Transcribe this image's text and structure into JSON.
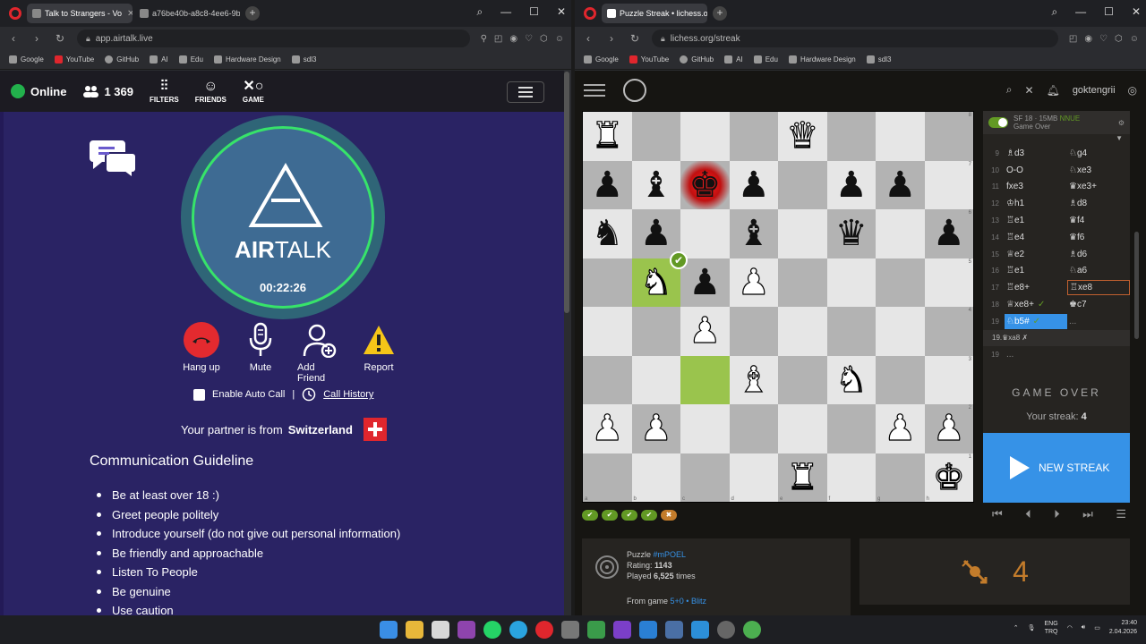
{
  "left_window": {
    "tabs": [
      {
        "label": "Talk to Strangers - Vo"
      },
      {
        "label": "a76be40b-a8c8-4ee6-9b8"
      }
    ],
    "url": "app.airtalk.live",
    "bookmarks": [
      "Google",
      "YouTube",
      "GitHub",
      "AI",
      "Edu",
      "Hardware Design",
      "sdl3"
    ]
  },
  "airtalk": {
    "status": "Online",
    "user_count": "1 369",
    "nav": {
      "filters": "FILTERS",
      "friends": "FRIENDS",
      "game": "GAME"
    },
    "logo_bold": "AIR",
    "logo_light": "TALK",
    "timer": "00:22:26",
    "actions": {
      "hangup": "Hang up",
      "mute": "Mute",
      "add_friend": "Add Friend",
      "report": "Report"
    },
    "auto_call": "Enable Auto Call",
    "separator": "|",
    "call_history": "Call History",
    "partner_prefix": "Your partner is from",
    "partner_country": "Switzerland",
    "guideline_title": "Communication Guideline",
    "guidelines": [
      "Be at least over 18 :)",
      "Greet people politely",
      "Introduce yourself (do not give out personal information)",
      "Be friendly and approachable",
      "Listen To People",
      "Be genuine",
      "Use caution"
    ]
  },
  "right_window": {
    "tabs": [
      {
        "label": "Puzzle Streak • lichess.org"
      }
    ],
    "url": "lichess.org/streak",
    "bookmarks": [
      "Google",
      "YouTube",
      "GitHub",
      "AI",
      "Edu",
      "Hardware Design",
      "sdl3"
    ]
  },
  "lichess": {
    "username": "goktengrii",
    "board": [
      [
        "wR",
        "",
        "",
        "",
        "wQ",
        "",
        "",
        ""
      ],
      [
        "bP",
        "bB",
        "bK",
        "bP",
        "",
        "bP",
        "bP",
        ""
      ],
      [
        "bN",
        "bP",
        "",
        "bB",
        "",
        "bQ",
        "",
        "bP"
      ],
      [
        "",
        "wN",
        "bP",
        "wP",
        "",
        "",
        "",
        ""
      ],
      [
        "",
        "",
        "wP",
        "",
        "",
        "",
        "",
        ""
      ],
      [
        "",
        "",
        "",
        "wB",
        "",
        "wN",
        "",
        ""
      ],
      [
        "wP",
        "wP",
        "",
        "",
        "",
        "",
        "wP",
        "wP"
      ],
      [
        "",
        "",
        "",
        "",
        "wR",
        "",
        "",
        "wK"
      ]
    ],
    "highlight_squares": [
      [
        3,
        1
      ],
      [
        5,
        2
      ]
    ],
    "check_square": [
      1,
      2
    ],
    "rank_labels": [
      "8",
      "7",
      "6",
      "5",
      "4",
      "3",
      "2",
      "1"
    ],
    "file_labels": [
      "a",
      "b",
      "c",
      "d",
      "e",
      "f",
      "g",
      "h"
    ],
    "puzzle_results": [
      "✔",
      "✔",
      "✔",
      "✔",
      "✖"
    ],
    "engine": {
      "name": "SF 18 · 15MB",
      "badge": "NNUE",
      "status": "Game Over"
    },
    "moves": [
      {
        "n": "9",
        "w": "♗d3",
        "b": "♘g4"
      },
      {
        "n": "10",
        "w": "O-O",
        "b": "♘xe3"
      },
      {
        "n": "11",
        "w": "fxe3",
        "b": "♛xe3+"
      },
      {
        "n": "12",
        "w": "♔h1",
        "b": "♗d8"
      },
      {
        "n": "13",
        "w": "♖e1",
        "b": "♛f4"
      },
      {
        "n": "14",
        "w": "♖e4",
        "b": "♛f6"
      },
      {
        "n": "15",
        "w": "♕e2",
        "b": "♗d6"
      },
      {
        "n": "16",
        "w": "♖e1",
        "b": "♘a6"
      },
      {
        "n": "17",
        "w": "♖e8+",
        "b": "♖xe8"
      },
      {
        "n": "18",
        "w": "♕xe8+",
        "b": "♚c7"
      },
      {
        "n": "19",
        "w": "♘b5#",
        "b": "..."
      }
    ],
    "variation": "19.♛xa8 ✗",
    "variation_row": {
      "n": "19",
      "w": "...",
      "b": ""
    },
    "game_over": "GAME OVER",
    "streak_label": "Your streak:",
    "streak_value": "4",
    "new_streak": "NEW STREAK",
    "puzzle_label": "Puzzle",
    "puzzle_id": "#mPOEL",
    "rating_label": "Rating:",
    "rating": "1143",
    "played_prefix": "Played",
    "played_count": "6,525",
    "played_suffix": "times",
    "from_game_label": "From game",
    "game_type": "5+0 • Blitz",
    "big_streak": "4"
  },
  "taskbar": {
    "lang_top": "ENG",
    "lang_bottom": "TRQ",
    "time": "23:40",
    "date": "2.04.2026"
  },
  "colors": {
    "airtalk_bg": "#2a2364",
    "online_green": "#22b14c",
    "hangup_red": "#e32a2f",
    "lichess_blue": "#3692e7",
    "lichess_green": "#629924"
  }
}
